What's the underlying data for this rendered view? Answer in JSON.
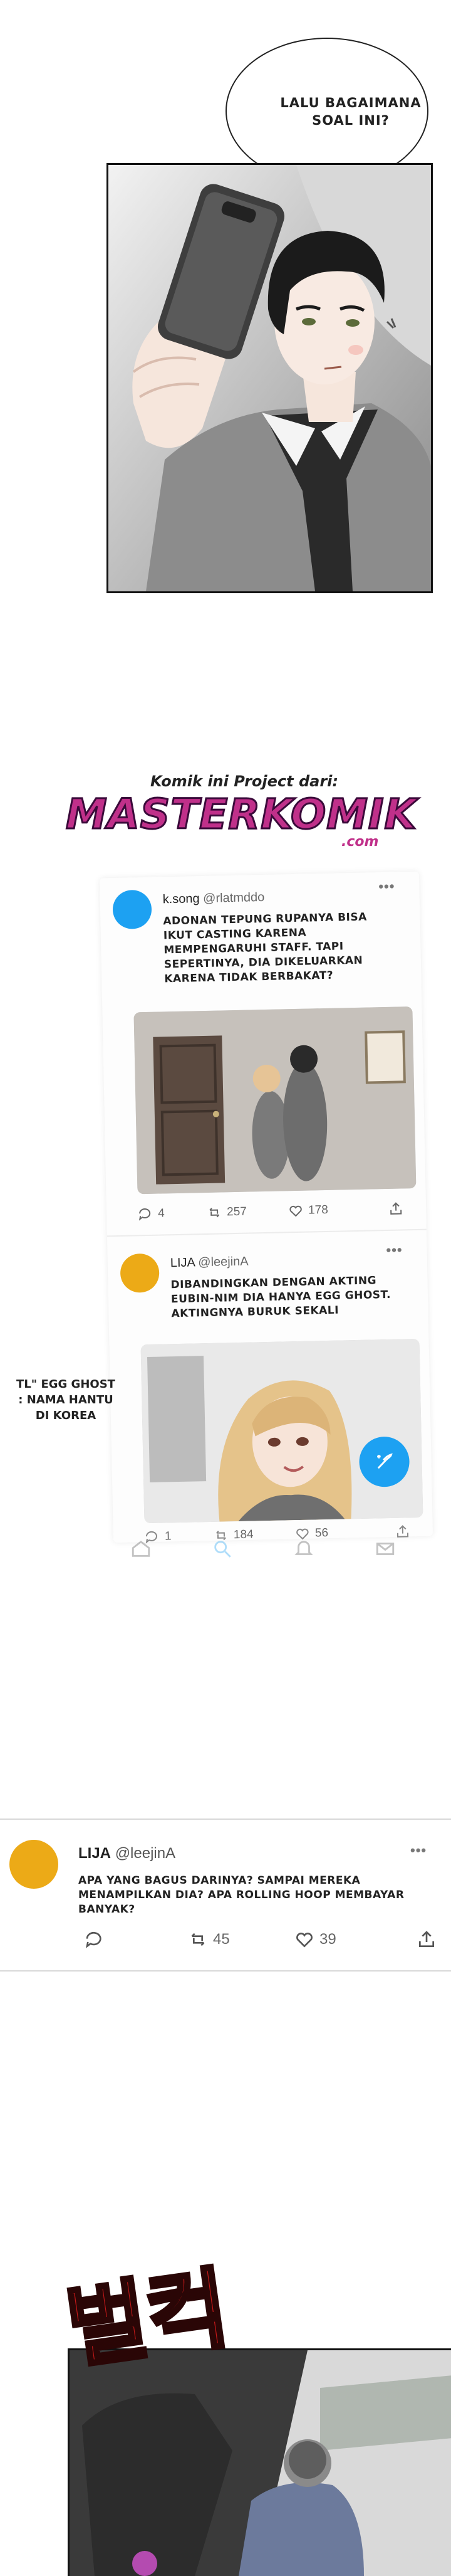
{
  "bubble": {
    "line1": "LALU BAGAIMANA",
    "line2": "SOAL INI?"
  },
  "watermark": {
    "small": "Komik ini Project dari:",
    "big": "MASTERKOMIK",
    "suffix": ".com"
  },
  "card_tweet1": {
    "name": "k.song",
    "handle": "@rlatmddo",
    "text": "ADONAN TEPUNG RUPANYA BISA IKUT CASTING KARENA MEMPENGARUHI STAFF. TAPI SEPERTINYA, DIA DIKELUARKAN KARENA TIDAK BERBAKAT?",
    "replies": "4",
    "retweets": "257",
    "likes": "178"
  },
  "card_tweet2": {
    "name": "LIJA",
    "handle": "@leejinA",
    "text": "DIBANDINGKAN DENGAN AKTING EUBIN-NIM DIA HANYA EGG GHOST. AKTINGNYA BURUK SEKALI",
    "replies": "1",
    "retweets": "184",
    "likes": "56"
  },
  "tl_note": "TL\" EGG GHOST : NAMA HANTU DI KOREA",
  "tweet_bottom": {
    "name": "LIJA",
    "handle": "@leejinA",
    "dots": "•••",
    "text": "APA YANG BAGUS DARINYA? SAMPAI MEREKA MENAMPILKAN DIA? APA ROLLING HOOP MEMBAYAR BANYAK?",
    "retweets": "45",
    "likes": "39"
  },
  "sfx": "벌컥",
  "colors": {
    "accent_twitter": "#1da1f2",
    "avatar_yellow": "#ecaa17",
    "sfx_red": "#c21818",
    "watermark_pink": "#c0308a"
  }
}
